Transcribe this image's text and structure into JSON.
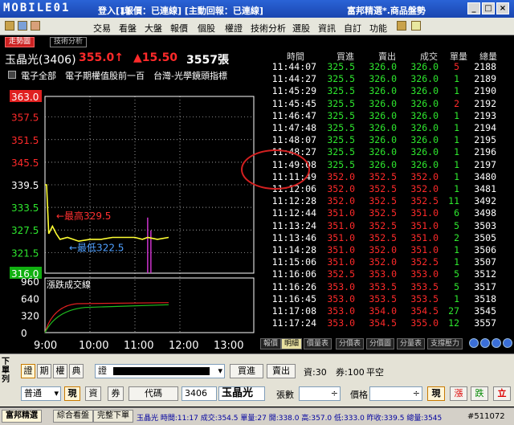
{
  "titlebar": {
    "brand": "MOBILE01",
    "login": "登入[1]",
    "status": "[報價：已連線] [主動回報：已連線]",
    "product": "富邦精選*.商品盤勢"
  },
  "menu": {
    "items": [
      "交易",
      "看盤",
      "大盤",
      "報價",
      "個股",
      "權證",
      "技術分析",
      "選股",
      "資訊",
      "自訂",
      "功能"
    ]
  },
  "tabs": [
    "走勢圖",
    "技術分析"
  ],
  "stock": {
    "name": "玉晶光(3406)",
    "price": "355.0↑",
    "change": "▲15.50",
    "volume": "3557張"
  },
  "categories": "電子全部　電子期權值股前一百　台灣-光學鏡頭指標",
  "chart_data": {
    "type": "line",
    "title": "",
    "ylim": [
      316.0,
      363.0
    ],
    "y_ticks": [
      "363.0",
      "357.5",
      "351.5",
      "345.5",
      "339.5",
      "333.5",
      "327.5",
      "321.5",
      "316.0"
    ],
    "x_ticks": [
      "9:00",
      "10:00",
      "11:00",
      "12:00",
      "13:00"
    ],
    "annotations": {
      "high": "←最高329.5",
      "low": "←最低322.5"
    },
    "series": [
      {
        "x": [
          "9:00",
          "9:05",
          "9:10",
          "9:15",
          "9:20",
          "9:30",
          "9:45",
          "10:00",
          "10:15",
          "10:30",
          "10:45",
          "11:00",
          "11:10",
          "11:17",
          "11:30",
          "11:45"
        ],
        "values": [
          339.5,
          326.5,
          328.5,
          326.5,
          325.0,
          325.5,
          324.5,
          325.0,
          325.0,
          325.5,
          325.5,
          325.5,
          325.0,
          325.5,
          325.0,
          325.5
        ]
      }
    ],
    "spike": {
      "time": "11:17",
      "low": 316.0,
      "high": 329.5
    },
    "volume_panel": {
      "label": "漲跌成交線",
      "y_ticks": [
        "960",
        "640",
        "320",
        "0"
      ],
      "ylim": [
        0,
        960
      ]
    }
  },
  "quotes": {
    "headers": [
      "時間",
      "買進",
      "賣出",
      "成交",
      "單量",
      "總量"
    ],
    "rows": [
      [
        "11:44:07",
        "325.5",
        "326.0",
        "326.0",
        "5",
        "2188",
        "g"
      ],
      [
        "11:44:27",
        "325.5",
        "326.0",
        "326.0",
        "1",
        "2189",
        "g"
      ],
      [
        "11:45:29",
        "325.5",
        "326.0",
        "326.0",
        "1",
        "2190",
        "g"
      ],
      [
        "11:45:45",
        "325.5",
        "326.0",
        "326.0",
        "2",
        "2192",
        "g"
      ],
      [
        "11:46:47",
        "325.5",
        "326.0",
        "326.0",
        "1",
        "2193",
        "g"
      ],
      [
        "11:47:48",
        "325.5",
        "326.0",
        "326.0",
        "1",
        "2194",
        "g"
      ],
      [
        "11:48:07",
        "325.5",
        "326.0",
        "326.0",
        "1",
        "2195",
        "g"
      ],
      [
        "11:48:27",
        "325.5",
        "326.0",
        "326.0",
        "1",
        "2196",
        "g"
      ],
      [
        "11:49:08",
        "325.5",
        "326.0",
        "326.0",
        "1",
        "2197",
        "g"
      ],
      [
        "11:11:49",
        "352.0",
        "352.5",
        "352.0",
        "1",
        "3480",
        "r"
      ],
      [
        "11:12:06",
        "352.0",
        "352.5",
        "352.0",
        "1",
        "3481",
        "r"
      ],
      [
        "11:12:28",
        "352.0",
        "352.5",
        "352.5",
        "11",
        "3492",
        "r"
      ],
      [
        "11:12:44",
        "351.0",
        "352.5",
        "351.0",
        "6",
        "3498",
        "r"
      ],
      [
        "11:13:24",
        "351.0",
        "352.5",
        "351.0",
        "5",
        "3503",
        "r"
      ],
      [
        "11:13:46",
        "351.0",
        "352.5",
        "351.0",
        "2",
        "3505",
        "r"
      ],
      [
        "11:14:28",
        "351.0",
        "352.0",
        "351.0",
        "1",
        "3506",
        "r"
      ],
      [
        "11:15:06",
        "351.0",
        "352.0",
        "352.5",
        "1",
        "3507",
        "r"
      ],
      [
        "11:16:06",
        "352.5",
        "353.0",
        "353.0",
        "5",
        "3512",
        "r"
      ],
      [
        "11:16:26",
        "353.0",
        "353.5",
        "353.5",
        "5",
        "3517",
        "r"
      ],
      [
        "11:16:45",
        "353.0",
        "353.5",
        "353.5",
        "1",
        "3518",
        "r"
      ],
      [
        "11:17:08",
        "353.0",
        "354.0",
        "354.5",
        "27",
        "3545",
        "r"
      ],
      [
        "11:17:24",
        "353.0",
        "354.5",
        "355.0",
        "12",
        "3557",
        "r"
      ]
    ]
  },
  "right_tabs": [
    "報價",
    "明細",
    "價量表",
    "分價表",
    "分價圖",
    "分量表",
    "支撐壓力"
  ],
  "order": {
    "side_label": "下單列",
    "kinds": [
      "證",
      "期",
      "權",
      "典"
    ],
    "account_prefix": "證",
    "buy_label": "買進",
    "sell_label": "賣出",
    "capital": "資:30",
    "coupon": "券:100",
    "flat": "平空",
    "type_value": "普通",
    "cash_label": "現",
    "margin_label": "資",
    "short_label": "券",
    "code_label": "代碼",
    "code_value": "3406",
    "stock_name": "玉晶光",
    "qty_label": "張數",
    "price_label": "價格",
    "now_label": "現",
    "up_label": "漲",
    "down_label": "跌",
    "place_label": "立"
  },
  "statusbar": {
    "tabs": [
      "富邦精選",
      "綜合看盤",
      "完整下單"
    ],
    "ticker": "玉晶光 時間:11:17 成交:354.5 單量:27 開:338.0 高:357.0 低:333.0 昨收:339.5 總量:3545",
    "stamp": "#511072"
  },
  "colors": {
    "up": "#ff2a2a",
    "down": "#2ee82e",
    "price_line": "#ffff33",
    "grid": "#ffffff",
    "spike": "#cc33cc",
    "title_bar": "#1a46b0"
  }
}
